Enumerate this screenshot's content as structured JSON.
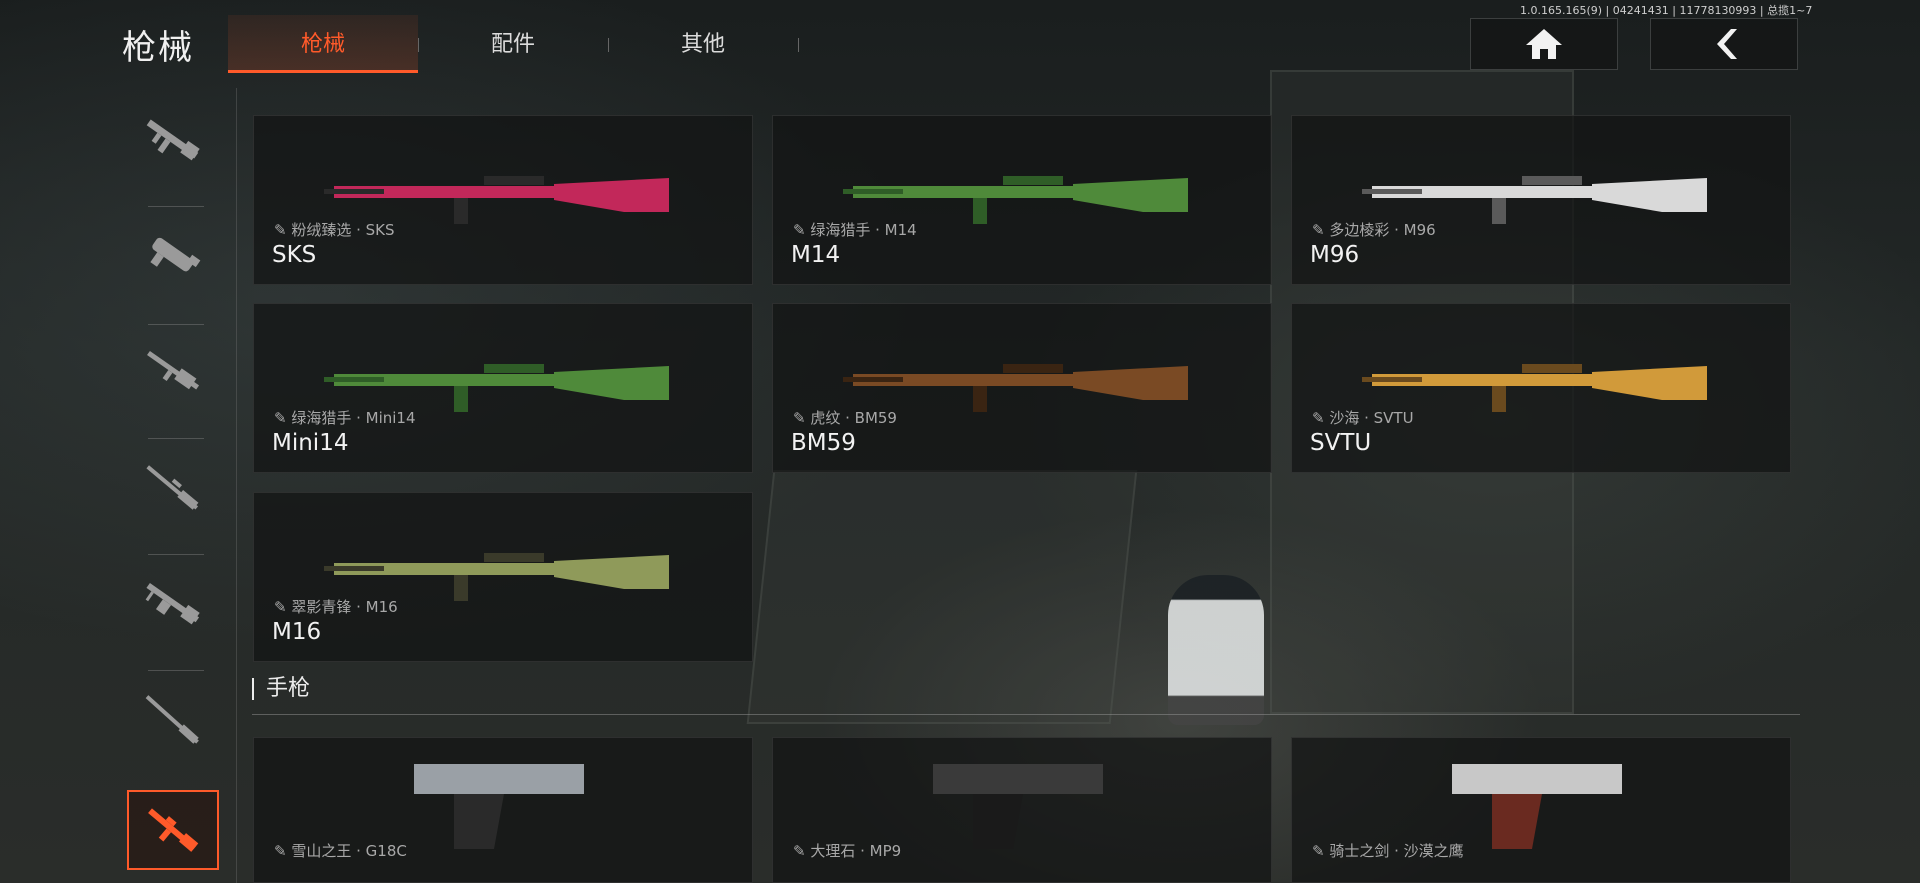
{
  "header": {
    "title": "枪械",
    "tabs": [
      {
        "label": "枪械",
        "active": true
      },
      {
        "label": "配件",
        "active": false
      },
      {
        "label": "其他",
        "active": false
      }
    ],
    "version": "1.0.165.165(9) | 04241431 | 11778130993 | 总揽1~7",
    "home_icon": "home-icon",
    "back_icon": "back-chevron-icon"
  },
  "sidebar": {
    "items": [
      {
        "icon": "assault-rifle-icon",
        "active": false
      },
      {
        "icon": "smg-icon",
        "active": false
      },
      {
        "icon": "shotgun-icon",
        "active": false
      },
      {
        "icon": "sniper-rifle-icon",
        "active": false
      },
      {
        "icon": "light-machine-gun-icon",
        "active": false
      },
      {
        "icon": "bolt-rifle-icon",
        "active": false
      },
      {
        "icon": "marksman-rifle-icon",
        "active": true
      }
    ]
  },
  "weapons": [
    {
      "skin": "粉绒臻选 · SKS",
      "name": "SKS",
      "colors": [
        "#c2285a",
        "#2a2a2a"
      ]
    },
    {
      "skin": "绿海猎手 · M14",
      "name": "M14",
      "colors": [
        "#4f8a3a",
        "#2f5d27"
      ]
    },
    {
      "skin": "多边棱彩 · M96",
      "name": "M96",
      "colors": [
        "#d9d9d9",
        "#5a5a5a"
      ]
    },
    {
      "skin": "绿海猎手 · Mini14",
      "name": "Mini14",
      "colors": [
        "#4f8a3a",
        "#2f5d27"
      ]
    },
    {
      "skin": "虎纹 · BM59",
      "name": "BM59",
      "colors": [
        "#7a4a24",
        "#3a2412"
      ]
    },
    {
      "skin": "沙海 · SVTU",
      "name": "SVTU",
      "colors": [
        "#d19a3a",
        "#6a4a1e"
      ]
    },
    {
      "skin": "翠影青锋 · M16",
      "name": "M16",
      "colors": [
        "#8f9a5a",
        "#3a3a2a"
      ]
    }
  ],
  "pistol_section": {
    "title": "手枪",
    "items": [
      {
        "skin": "雪山之王 · G18C",
        "colors": [
          "#9aa0a6",
          "#2a2a2a"
        ]
      },
      {
        "skin": "大理石 · MP9",
        "colors": [
          "#3a3a3a",
          "#1a1a1a"
        ]
      },
      {
        "skin": "骑士之剑 · 沙漠之鹰",
        "colors": [
          "#c8c8c8",
          "#6a2a20"
        ]
      }
    ]
  },
  "accent_color": "#ff5a2a"
}
